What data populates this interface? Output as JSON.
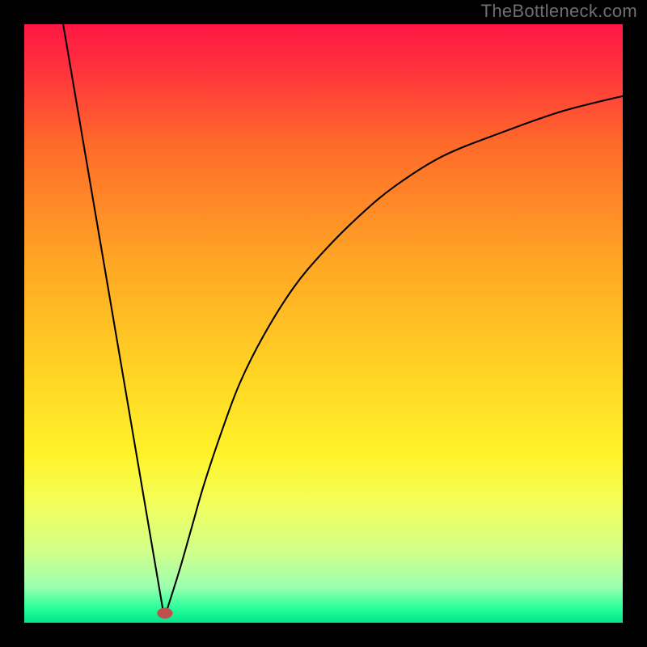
{
  "watermark": "TheBottleneck.com",
  "chart_data": {
    "type": "line",
    "title": "",
    "xlabel": "",
    "ylabel": "",
    "xlim": [
      0,
      100
    ],
    "ylim": [
      0,
      100
    ],
    "grid": false,
    "legend": false,
    "gradient_stops": [
      {
        "pos": 0.0,
        "color": "#ff1744"
      },
      {
        "pos": 0.06,
        "color": "#ff2c3f"
      },
      {
        "pos": 0.2,
        "color": "#ff6a2a"
      },
      {
        "pos": 0.4,
        "color": "#ffa724"
      },
      {
        "pos": 0.58,
        "color": "#ffd324"
      },
      {
        "pos": 0.72,
        "color": "#fff32a"
      },
      {
        "pos": 0.8,
        "color": "#f3ff5a"
      },
      {
        "pos": 0.88,
        "color": "#d3ff8a"
      },
      {
        "pos": 0.94,
        "color": "#9cffb0"
      },
      {
        "pos": 0.975,
        "color": "#2bff9a"
      },
      {
        "pos": 1.0,
        "color": "#00e58b"
      }
    ],
    "series": [
      {
        "name": "left-ray",
        "x": [
          6.5,
          23.2
        ],
        "y": [
          100,
          2.0
        ]
      },
      {
        "name": "right-curve",
        "x": [
          23.8,
          26,
          28,
          30,
          33,
          36,
          40,
          45,
          50,
          56,
          62,
          70,
          80,
          90,
          100
        ],
        "y": [
          2.0,
          9,
          16,
          23,
          32,
          40,
          48,
          56,
          62,
          68,
          73,
          78,
          82,
          85.5,
          88
        ]
      }
    ],
    "marker": {
      "x": 23.5,
      "y": 1.6,
      "rx": 1.3,
      "ry": 0.9,
      "fill": "#c0504d"
    }
  }
}
